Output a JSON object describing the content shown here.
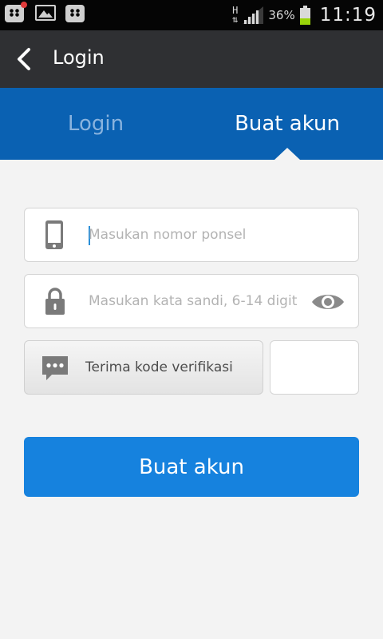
{
  "status_bar": {
    "network": "H",
    "battery_percent": "36%",
    "battery_level": 0.36,
    "time": "11:19",
    "icons": [
      "bbm-notification-icon",
      "image-icon",
      "bbm-icon",
      "data-arrows-icon",
      "signal-icon",
      "battery-icon"
    ]
  },
  "action_bar": {
    "title": "Login",
    "back_icon": "chevron-left-icon"
  },
  "tabs": {
    "items": [
      {
        "label": "Login",
        "selected": false
      },
      {
        "label": "Buat akun",
        "selected": true
      }
    ]
  },
  "form": {
    "phone": {
      "placeholder": "Masukan nomor ponsel",
      "value": "",
      "icon": "phone-icon"
    },
    "password": {
      "placeholder": "Masukan kata sandi, 6-14 digit",
      "value": "",
      "icon": "lock-icon",
      "toggle_icon": "eye-icon"
    },
    "verification": {
      "button_label": "Terima kode verifikasi",
      "icon": "message-icon",
      "code_value": ""
    },
    "submit_label": "Buat akun"
  },
  "colors": {
    "tab_bar": "#0a61b2",
    "submit_button": "#1682de",
    "action_bar": "#2f3033",
    "battery_fill": "#9ad40a"
  }
}
